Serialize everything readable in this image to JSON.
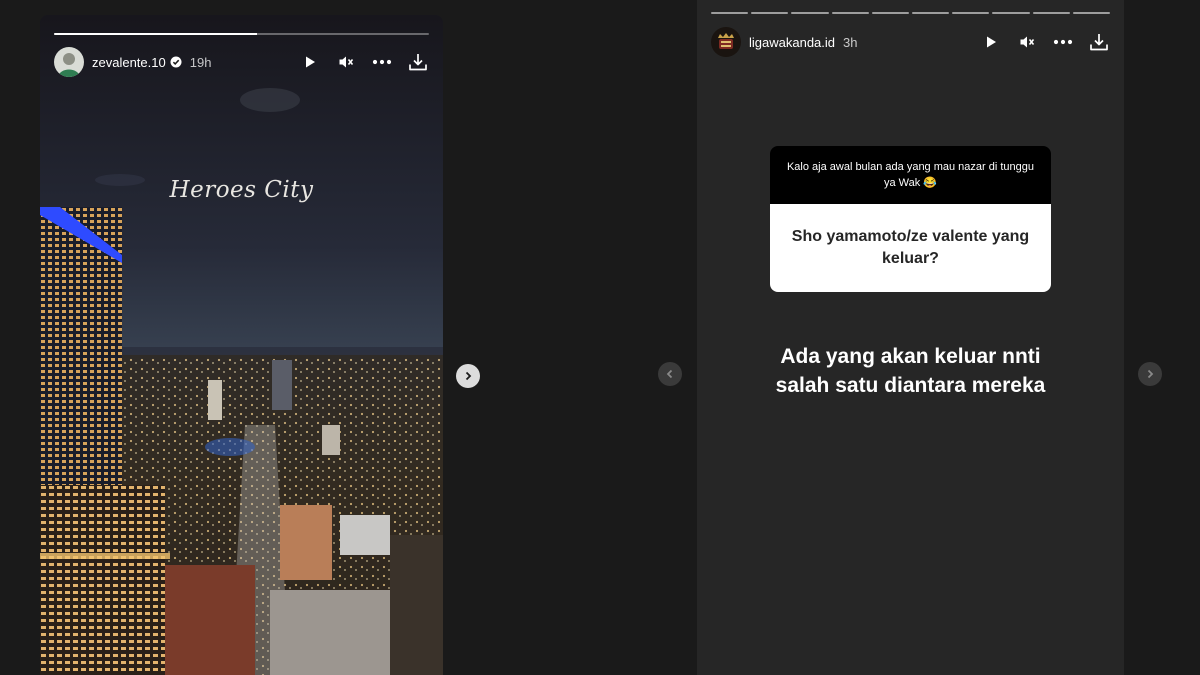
{
  "story_left": {
    "username": "zevalente.10",
    "time": "19h",
    "progress": 0.54,
    "caption": "Heroes City",
    "icons": [
      "verified-badge-icon",
      "play-icon",
      "mute-icon",
      "more-icon",
      "download-icon"
    ]
  },
  "story_right": {
    "username": "ligawakanda.id",
    "time": "3h",
    "progress_segments": 10,
    "question_prompt": "Kalo aja awal bulan ada yang mau nazar di tunggu ya Wak 😂",
    "question_text": "Sho yamamoto/ze valente yang keluar?",
    "answer_line1": "Ada yang akan keluar nnti",
    "answer_line2": "salah satu diantara mereka",
    "icons": [
      "play-icon",
      "mute-icon",
      "more-icon",
      "download-icon"
    ]
  },
  "nav": {
    "icons": [
      "chevron-right-icon",
      "chevron-left-icon",
      "chevron-right-icon"
    ]
  },
  "colors": {
    "background": "#1a1a1a",
    "story_bg": "#262626",
    "question_header": "#000000",
    "question_body": "#ffffff"
  }
}
